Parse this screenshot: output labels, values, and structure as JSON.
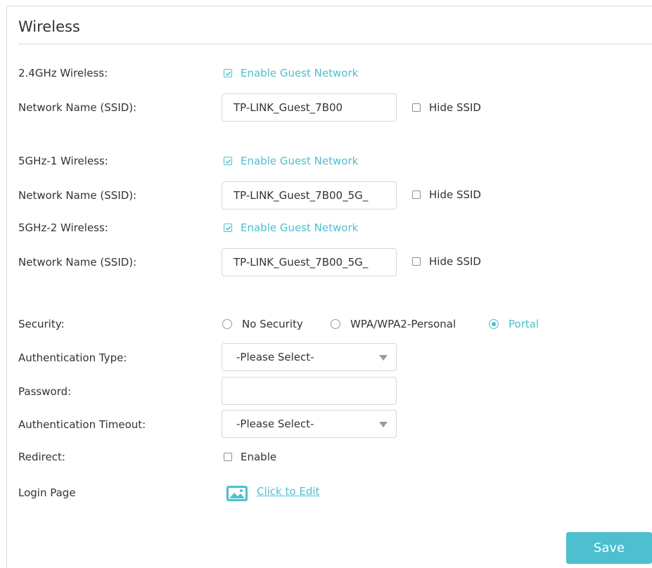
{
  "title": "Wireless",
  "wireless_24": {
    "label": "2.4GHz Wireless:",
    "enable_label": "Enable Guest Network",
    "enabled": true,
    "ssid_label": "Network Name (SSID):",
    "ssid_value": "TP-LINK_Guest_7B00",
    "hide_label": "Hide SSID",
    "hide_checked": false
  },
  "wireless_5g1": {
    "label": "5GHz-1 Wireless:",
    "enable_label": "Enable Guest Network",
    "enabled": true,
    "ssid_label": "Network Name (SSID):",
    "ssid_value": "TP-LINK_Guest_7B00_5G_",
    "hide_label": "Hide SSID",
    "hide_checked": false
  },
  "wireless_5g2": {
    "label": "5GHz-2 Wireless:",
    "enable_label": "Enable Guest Network",
    "enabled": true,
    "ssid_label": "Network Name (SSID):",
    "ssid_value": "TP-LINK_Guest_7B00_5G_",
    "hide_label": "Hide SSID",
    "hide_checked": false
  },
  "security": {
    "label": "Security:",
    "options": [
      "No Security",
      "WPA/WPA2-Personal",
      "Portal"
    ],
    "selected": "Portal"
  },
  "auth_type": {
    "label": "Authentication Type:",
    "value": "-Please Select-"
  },
  "password": {
    "label": "Password:",
    "value": ""
  },
  "auth_timeout": {
    "label": "Authentication Timeout:",
    "value": "-Please Select-"
  },
  "redirect": {
    "label": "Redirect:",
    "enable_label": "Enable",
    "checked": false
  },
  "login_page": {
    "label": "Login Page",
    "link": "Click to Edit"
  },
  "save_label": "Save",
  "colors": {
    "accent": "#4dbfcf",
    "text": "#333333",
    "border": "#d6d6d6"
  },
  "icons": {
    "checkbox_checked": "check-icon",
    "image": "image-icon",
    "dropdown": "chevron-down-icon"
  }
}
